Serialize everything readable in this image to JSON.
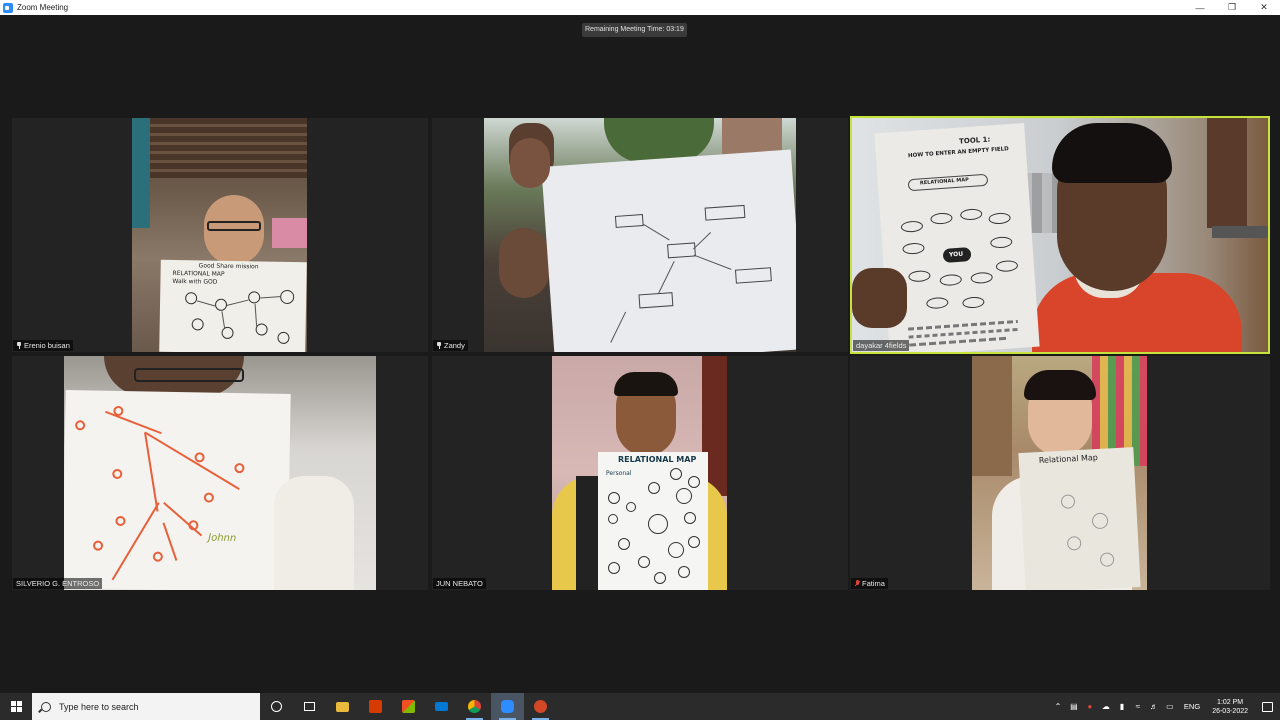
{
  "window": {
    "title": "Zoom Meeting"
  },
  "meeting": {
    "remaining_time": "Remaining Meeting Time: 03:19"
  },
  "participants": [
    {
      "name": "Erenio buisan",
      "pinned": true,
      "paper_text": [
        "Good Share mission",
        "RELATIONAL MAP",
        "Walk with GOD"
      ]
    },
    {
      "name": "Zandy",
      "pinned": true
    },
    {
      "name": "dayakar 4fields",
      "active_speaker": true,
      "paper_text": [
        "TOOL 1:",
        "HOW TO ENTER AN EMPTY FIELD",
        "RELATIONAL MAP",
        "YOU"
      ]
    },
    {
      "name": "SILVERIO G. ENTROSO",
      "paper_text": [
        "Johnn"
      ]
    },
    {
      "name": "JUN NEBATO",
      "paper_text": [
        "RELATIONAL MAP",
        "Personal"
      ]
    },
    {
      "name": "Fatima",
      "muted": true,
      "paper_text": [
        "Relational Map"
      ]
    }
  ],
  "taskbar": {
    "search_placeholder": "Type here to search",
    "apps": [
      "task-view",
      "file-explorer",
      "office",
      "store",
      "mail",
      "chrome",
      "zoom",
      "powerpoint"
    ],
    "language": "ENG",
    "time": "1:02 PM",
    "date": "26-03-2022"
  },
  "colors": {
    "active_speaker_border": "#c6e23b",
    "taskbar": "#2b2b2b",
    "meeting_bg": "#1a1a1a"
  }
}
